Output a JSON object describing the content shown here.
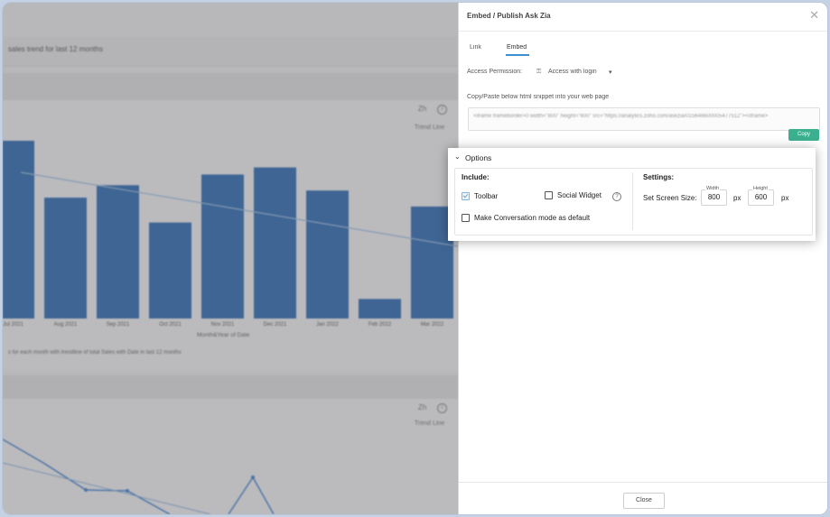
{
  "background": {
    "chart_header": "sales trend for last 12 months",
    "toolbar": {
      "zoom_label": "Zh",
      "info_icon": "info-icon",
      "trend_line": "Trend Line"
    },
    "chart_data": {
      "type": "bar",
      "categories": [
        "Jul 2021",
        "Aug 2021",
        "Sep 2021",
        "Oct 2021",
        "Nov 2021",
        "Dec 2021",
        "Jan 2022",
        "Feb 2022",
        "Mar 2022"
      ],
      "values": [
        100,
        68,
        75,
        54,
        81,
        85,
        72,
        11,
        63
      ],
      "xlabel": "Month&Year of Date",
      "series": [
        {
          "values": [
            100,
            68,
            75,
            54,
            81,
            85,
            72,
            11,
            63
          ]
        }
      ],
      "trend_line": true,
      "color": "#2f6db5"
    },
    "caption": "s for each month with trendline of total Sales with Date in last 12 months",
    "second_chart": {
      "toolbar": {
        "zoom_label": "Zh",
        "trend_line": "Trend Line"
      }
    }
  },
  "modal": {
    "title": "Embed / Publish Ask Zia",
    "close_icon": "close-icon",
    "tabs": [
      {
        "label": "Link"
      },
      {
        "label": "Embed",
        "active": true
      }
    ],
    "access_label": "Access Permission:",
    "access_value": "Access with login",
    "snippet_label": "Copy/Paste below html snippet into your web page",
    "snippet_text": "<iframe frameborder=0 width=\"800\" height=\"600\" src=\"https://analytics.zoho.com/askzia/015646600005477512\"></iframe>",
    "copy_button": "Copy",
    "close_button": "Close"
  },
  "options": {
    "title": "Options",
    "include_label": "Include:",
    "toolbar_label": "Toolbar",
    "toolbar_checked": true,
    "social_widget_label": "Social Widget",
    "social_widget_checked": false,
    "conversation_label": "Make Conversation mode as default",
    "conversation_checked": false,
    "settings_label": "Settings:",
    "screen_size_label": "Set Screen Size:",
    "width_label": "Width",
    "width_value": "800",
    "height_label": "Height",
    "height_value": "600",
    "unit": "px",
    "help_icon": "help-icon",
    "collapse_icon": "chevron-down-icon"
  }
}
